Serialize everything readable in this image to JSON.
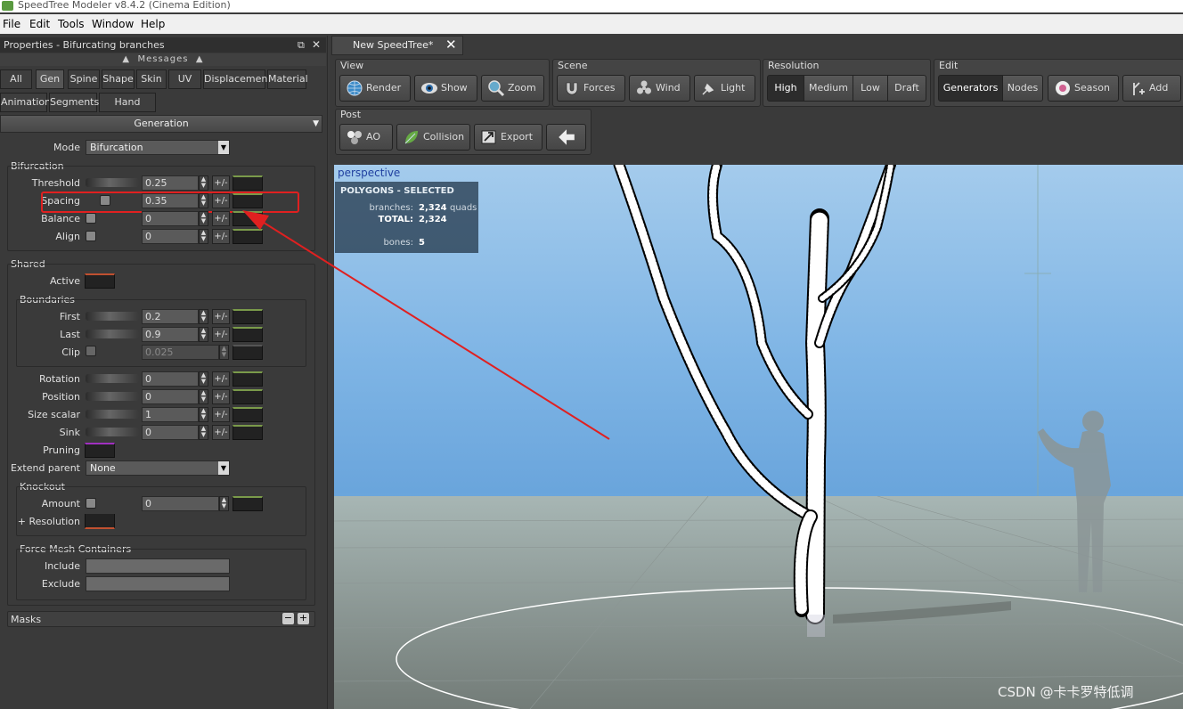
{
  "window": {
    "title": "SpeedTree Modeler v8.4.2 (Cinema Edition)"
  },
  "menu": [
    "File",
    "Edit",
    "Tools",
    "Window",
    "Help"
  ],
  "properties": {
    "title": "Properties - Bifurcating branches",
    "messages": "Messages",
    "tabs_row1": [
      "All",
      "Gen",
      "Spine",
      "Shape",
      "Skin",
      "UV",
      "Displacement",
      "Material"
    ],
    "tabs_row2": [
      "Animation",
      "Segments",
      "Hand Drawn"
    ],
    "section_header": "Generation",
    "mode": {
      "label": "Mode",
      "value": "Bifurcation"
    },
    "bifurcation": {
      "title": "Bifurcation",
      "threshold": {
        "label": "Threshold",
        "value": "0.25"
      },
      "spacing": {
        "label": "Spacing",
        "value": "0.35"
      },
      "balance": {
        "label": "Balance",
        "value": "0"
      },
      "align": {
        "label": "Align",
        "value": "0"
      }
    },
    "shared": {
      "title": "Shared",
      "active": "Active",
      "boundaries": {
        "title": "Boundaries",
        "first": {
          "label": "First",
          "value": "0.2"
        },
        "last": {
          "label": "Last",
          "value": "0.9"
        },
        "clip": {
          "label": "Clip",
          "value": "0.025"
        }
      },
      "rotation": {
        "label": "Rotation",
        "value": "0"
      },
      "position": {
        "label": "Position",
        "value": "0"
      },
      "size_scalar": {
        "label": "Size scalar",
        "value": "1"
      },
      "sink": {
        "label": "Sink",
        "value": "0"
      },
      "pruning": "Pruning",
      "extend_parent": {
        "label": "Extend parent",
        "value": "None"
      },
      "knockout": {
        "title": "Knockout",
        "amount": {
          "label": "Amount",
          "value": "0"
        },
        "resolution": "+ Resolution"
      },
      "force_mesh": {
        "title": "Force Mesh Containers",
        "include": "Include",
        "exclude": "Exclude"
      }
    },
    "masks": "Masks",
    "pm_label": "+/-"
  },
  "document_tab": "New SpeedTree*",
  "toolbar": {
    "view": {
      "title": "View",
      "buttons": [
        "Render",
        "Show",
        "Zoom"
      ]
    },
    "scene": {
      "title": "Scene",
      "buttons": [
        "Forces",
        "Wind",
        "Light"
      ]
    },
    "resolution": {
      "title": "Resolution",
      "buttons": [
        "High",
        "Medium",
        "Low",
        "Draft"
      ],
      "selected": "High"
    },
    "edit": {
      "title": "Edit",
      "buttons": [
        "Generators",
        "Nodes",
        "Season",
        "Add"
      ],
      "selected": "Generators"
    },
    "post": {
      "title": "Post",
      "buttons": [
        "AO",
        "Collision",
        "Export"
      ]
    }
  },
  "viewport": {
    "label": "perspective",
    "stats": {
      "header": "POLYGONS - SELECTED",
      "branches_label": "branches:",
      "branches_value": "2,324",
      "branches_unit": "quads",
      "total_label": "TOTAL:",
      "total_value": "2,324",
      "bones_label": "bones:",
      "bones_value": "5"
    }
  },
  "watermark": "CSDN @卡卡罗特低调",
  "colors": {
    "highlight_box": "#e02020",
    "arrow": "#e02020",
    "viewport_sky": "#7fb5e5"
  }
}
